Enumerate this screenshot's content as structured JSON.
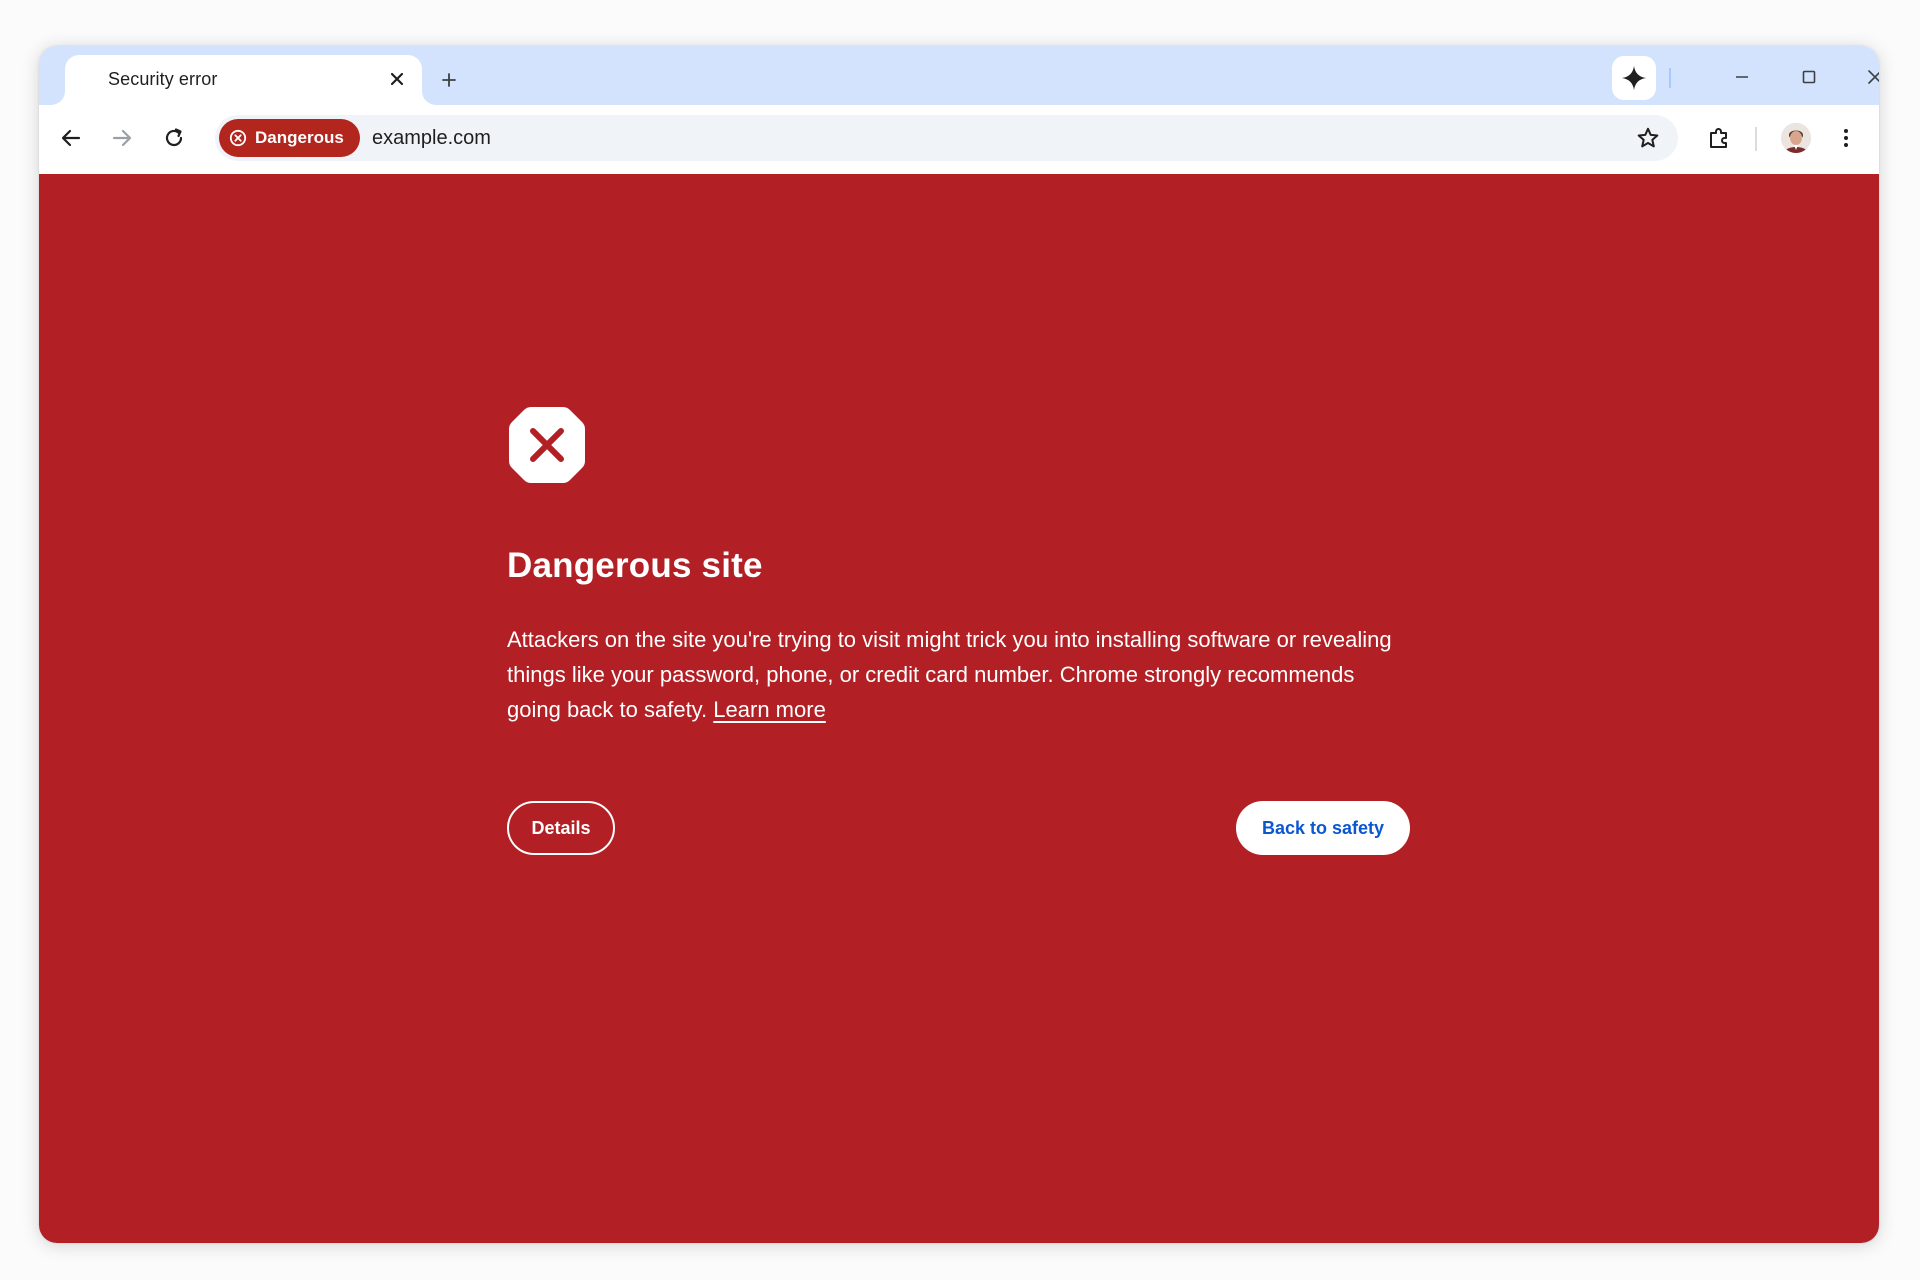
{
  "tab": {
    "title": "Security error",
    "close_icon": "close-icon"
  },
  "new_tab_icon": "plus-icon",
  "window_controls": [
    "minimize-icon",
    "maximize-icon",
    "close-icon"
  ],
  "toolbar": {
    "back_icon": "arrow-back-icon",
    "forward_icon": "arrow-forward-icon",
    "reload_icon": "reload-icon"
  },
  "omnibox": {
    "security_chip_label": "Dangerous",
    "url": "example.com"
  },
  "page": {
    "heading": "Dangerous site",
    "body": "Attackers on the site you're trying to visit might trick you into installing software or revealing things like your password, phone, or credit card number. Chrome strongly recommends going back to safety.",
    "learn_more": "Learn more",
    "details_button": "Details",
    "back_to_safety_button": "Back to safety"
  },
  "colors": {
    "tab_strip": "#d3e3fd",
    "danger_background": "#b21f24",
    "danger_chip": "#b3261e",
    "primary_button_text": "#0b57d0",
    "text_on_danger": "#ffffff"
  }
}
